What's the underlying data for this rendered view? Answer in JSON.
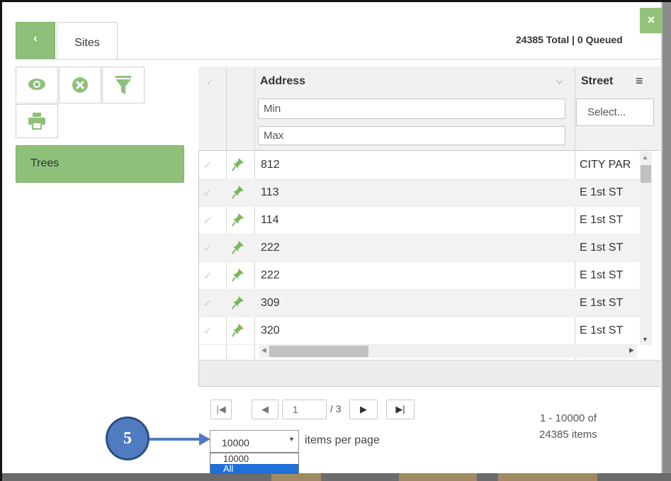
{
  "header": {
    "back_glyph": "‹",
    "tab_label": "Sites",
    "total_text": "24385 Total | 0 Queued",
    "close_glyph": "×"
  },
  "toolbar": {
    "icons": [
      "eye-icon",
      "cancel-circle-icon",
      "filter-icon",
      "print-icon"
    ]
  },
  "sidebar": {
    "layer_label": "Trees"
  },
  "grid": {
    "columns": {
      "address": {
        "title": "Address",
        "min_placeholder": "Min",
        "max_placeholder": "Max"
      },
      "street": {
        "title": "Street",
        "select_placeholder": "Select..."
      }
    },
    "rows": [
      {
        "address": "812",
        "street": "CITY PAR"
      },
      {
        "address": "113",
        "street": "E 1st ST"
      },
      {
        "address": "114",
        "street": "E 1st ST"
      },
      {
        "address": "222",
        "street": "E 1st ST"
      },
      {
        "address": "222",
        "street": "E 1st ST"
      },
      {
        "address": "309",
        "street": "E 1st ST"
      },
      {
        "address": "320",
        "street": "E 1st ST"
      }
    ]
  },
  "pager": {
    "page_value": "1",
    "page_of": "/ 3",
    "range_line1": "1 - 10000 of",
    "range_line2": "24385 items",
    "per_page_selected": "10000",
    "per_page_label": "items per page",
    "per_page_options": [
      "10000",
      "All"
    ],
    "highlighted_option": "All"
  },
  "callout": {
    "number": "5"
  },
  "colors": {
    "accent_green": "#8ec07a",
    "callout_blue": "#4f7cc0",
    "selection_blue": "#1e6fd8"
  }
}
